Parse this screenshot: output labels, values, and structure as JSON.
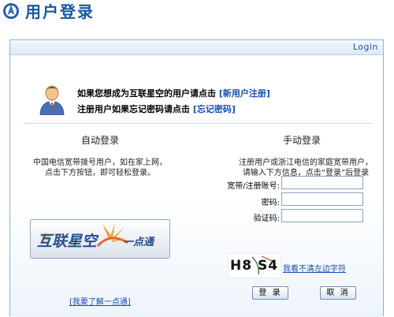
{
  "header": {
    "title": "用户登录"
  },
  "panel": {
    "tab_label": "Login"
  },
  "notice": {
    "line1_prefix": "如果您想成为互联星空的用户请点击",
    "register_link": "[新用户注册]",
    "line2_prefix": "注册用户如果忘记密码请点击",
    "forgot_link": "[忘记密码]"
  },
  "auto_login": {
    "title": "自动登录",
    "desc_line1": "中国电信宽带拨号用户，如在家上网，",
    "desc_line2": "点击下方按钮，即可轻松登录。",
    "logo_text_main": "互联星空",
    "logo_text_sub": "一点通",
    "learn_link": "[我要了解一点通]"
  },
  "manual_login": {
    "title": "手动登录",
    "desc_line1": "注册用户或浙江电信的家庭宽带用户，",
    "desc_line2": "请输入下方信息，点击“登录”后登录",
    "account_label": "宽带/注册账号:",
    "account_value": "",
    "password_label": "密码:",
    "password_value": "",
    "captcha_label": "验证码:",
    "captcha_value": "",
    "captcha_text": "H8 S4",
    "captcha_refresh_link": "我看不清左边字符",
    "login_button": "登 录",
    "cancel_button": "取 消"
  },
  "colors": {
    "title_blue": "#1a55a0",
    "link_blue": "#1a4fb0",
    "border_blue": "#8fb2d9"
  }
}
